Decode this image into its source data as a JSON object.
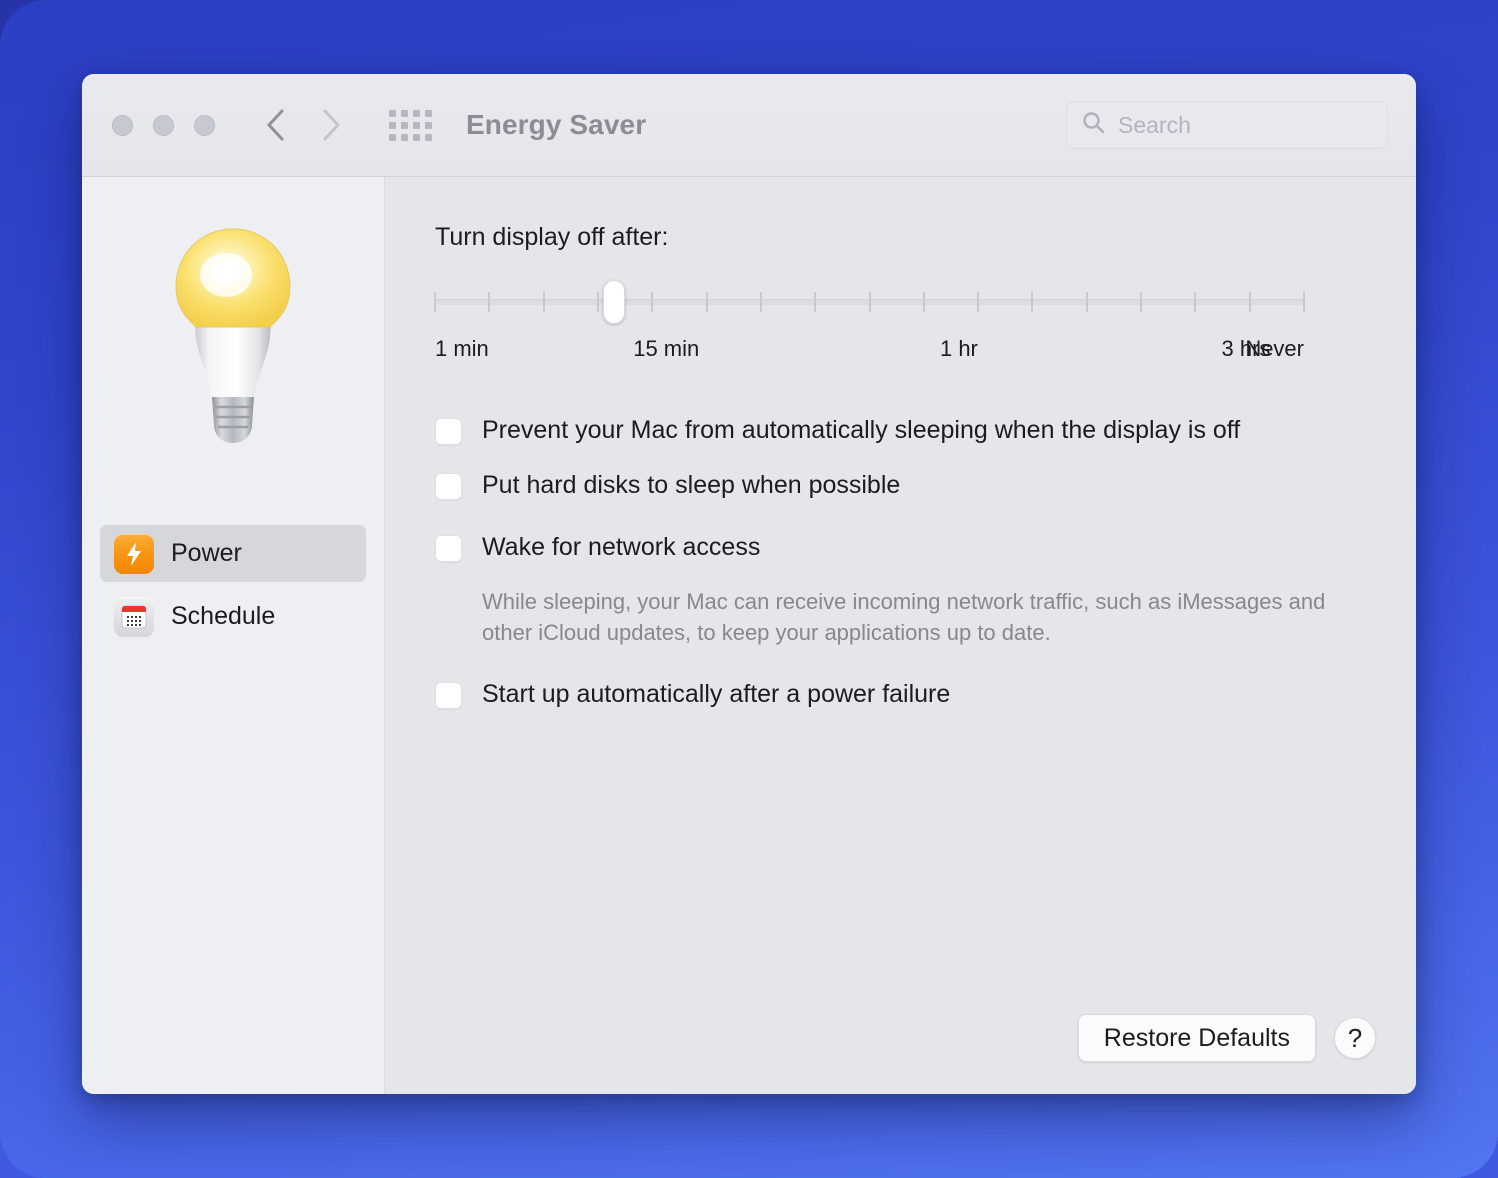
{
  "window": {
    "title": "Energy Saver",
    "traffic_lights": [
      "close-button",
      "minimize-button",
      "zoom-button"
    ],
    "nav": {
      "back": "back-chevron",
      "forward": "forward-chevron"
    },
    "grid_button": "show-all-preferences-icon"
  },
  "search": {
    "placeholder": "Search",
    "value": "",
    "icon": "search-icon"
  },
  "sidebar": {
    "hero_icon": "lightbulb-icon",
    "items": [
      {
        "label": "Power",
        "icon": "power-bolt-icon",
        "selected": true
      },
      {
        "label": "Schedule",
        "icon": "calendar-icon",
        "selected": false
      }
    ]
  },
  "main": {
    "section_title": "Turn display off after:",
    "slider": {
      "tick_count": 17,
      "thumb_position_percent": 20.6,
      "labels": [
        {
          "text": "1 min",
          "position_percent": 0
        },
        {
          "text": "15 min",
          "position_percent": 23.5
        },
        {
          "text": "1 hr",
          "position_percent": 58.8
        },
        {
          "text": "3 hrs",
          "position_percent": 91.2
        },
        {
          "text": "Never",
          "position_percent": 100
        }
      ]
    },
    "checkboxes": [
      {
        "label": "Prevent your Mac from automatically sleeping when the display is off",
        "checked": false,
        "description": ""
      },
      {
        "label": "Put hard disks to sleep when possible",
        "checked": false,
        "description": ""
      },
      {
        "label": "Wake for network access",
        "checked": false,
        "description": "While sleeping, your Mac can receive incoming network traffic, such as iMessages and other iCloud updates, to keep your applications up to date."
      },
      {
        "label": "Start up automatically after a power failure",
        "checked": false,
        "description": ""
      }
    ],
    "footer": {
      "restore_label": "Restore Defaults",
      "help_label": "?"
    }
  },
  "colors": {
    "accent_orange": "#f7920f",
    "calendar_red": "#e8362f",
    "desktop_blue": "#3c55dd",
    "window_bg": "#e5e6ea",
    "sidebar_bg": "#eeeff2"
  }
}
